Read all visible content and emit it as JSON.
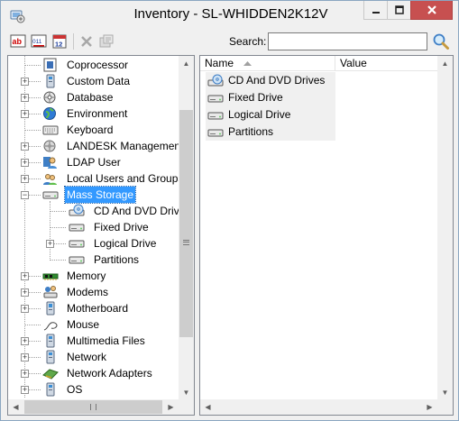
{
  "window": {
    "title": "Inventory - SL-WHIDDEN2K12V",
    "controls": [
      "minimize",
      "maximize",
      "close"
    ]
  },
  "toolbar": {
    "buttons": [
      {
        "name": "ab-field-icon"
      },
      {
        "name": "binary-field-icon"
      },
      {
        "name": "calendar-12-icon"
      },
      {
        "name": "delete-x-icon",
        "disabled": true
      },
      {
        "name": "properties-icon",
        "disabled": true
      }
    ],
    "search_label": "Search:",
    "search_value": "",
    "search_icon": "magnifier-icon"
  },
  "tree": {
    "items": [
      {
        "label": "Coprocessor",
        "icon": "coprocessor-icon",
        "level": 1,
        "expander": "none"
      },
      {
        "label": "Custom Data",
        "icon": "computer-icon",
        "level": 1,
        "expander": "plus"
      },
      {
        "label": "Database",
        "icon": "database-icon",
        "level": 1,
        "expander": "plus"
      },
      {
        "label": "Environment",
        "icon": "environment-icon",
        "level": 1,
        "expander": "plus"
      },
      {
        "label": "Keyboard",
        "icon": "keyboard-icon",
        "level": 1,
        "expander": "none"
      },
      {
        "label": "LANDESK Management",
        "icon": "landesk-icon",
        "level": 1,
        "expander": "plus"
      },
      {
        "label": "LDAP User",
        "icon": "user-icon",
        "level": 1,
        "expander": "plus"
      },
      {
        "label": "Local Users and Groups",
        "icon": "users-group-icon",
        "level": 1,
        "expander": "plus"
      },
      {
        "label": "Mass Storage",
        "icon": "drive-icon",
        "level": 1,
        "expander": "minus",
        "selected": true
      },
      {
        "label": "CD And DVD Drives",
        "icon": "cd-drive-icon",
        "level": 2,
        "expander": "none"
      },
      {
        "label": "Fixed Drive",
        "icon": "drive-icon",
        "level": 2,
        "expander": "none"
      },
      {
        "label": "Logical Drive",
        "icon": "drive-icon",
        "level": 2,
        "expander": "plus"
      },
      {
        "label": "Partitions",
        "icon": "drive-icon",
        "level": 2,
        "expander": "none"
      },
      {
        "label": "Memory",
        "icon": "memory-icon",
        "level": 1,
        "expander": "plus"
      },
      {
        "label": "Modems",
        "icon": "modem-icon",
        "level": 1,
        "expander": "plus"
      },
      {
        "label": "Motherboard",
        "icon": "motherboard-icon",
        "level": 1,
        "expander": "plus"
      },
      {
        "label": "Mouse",
        "icon": "mouse-icon",
        "level": 1,
        "expander": "none"
      },
      {
        "label": "Multimedia Files",
        "icon": "computer-icon",
        "level": 1,
        "expander": "plus"
      },
      {
        "label": "Network",
        "icon": "network-icon",
        "level": 1,
        "expander": "plus"
      },
      {
        "label": "Network Adapters",
        "icon": "network-adapter-icon",
        "level": 1,
        "expander": "plus"
      },
      {
        "label": "OS",
        "icon": "computer-icon",
        "level": 1,
        "expander": "plus"
      }
    ]
  },
  "list": {
    "columns": [
      {
        "label": "Name",
        "sorted": "ascending"
      },
      {
        "label": "Value"
      }
    ],
    "rows": [
      {
        "name": "CD And DVD Drives",
        "icon": "cd-drive-icon"
      },
      {
        "name": "Fixed Drive",
        "icon": "drive-icon"
      },
      {
        "name": "Logical Drive",
        "icon": "drive-icon"
      },
      {
        "name": "Partitions",
        "icon": "drive-icon"
      }
    ]
  },
  "colors": {
    "selection": "#3399ff",
    "close_button": "#c75050",
    "border": "#828790"
  }
}
